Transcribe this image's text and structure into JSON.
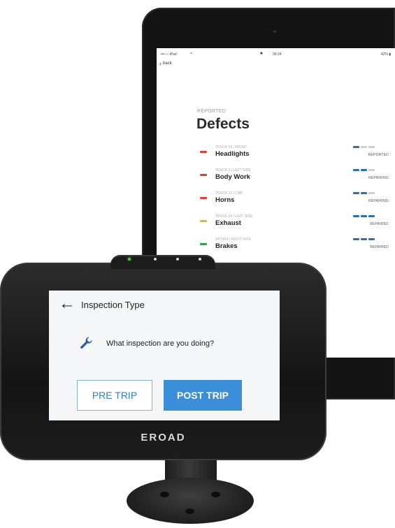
{
  "ipad": {
    "status_bar": {
      "carrier": "•••○○ iPad",
      "wifi_icon": "wifi-icon",
      "lock_icon": "lock-icon",
      "time": "09:24",
      "battery": "  42% ▮"
    },
    "back_label": "back",
    "section_label": "REPORTED",
    "title": "Defects",
    "defects": [
      {
        "sub": "TRUCK 54 | FRONT",
        "name": "Headlights",
        "status": "REPORTED",
        "color": "#e8402f",
        "progress": 1
      },
      {
        "sub": "TRUCK 3 | LEFT SIDE",
        "name": "Body Work",
        "status": "REPAIRING",
        "color": "#e8402f",
        "progress": 2
      },
      {
        "sub": "TRUCK 12 | CAB",
        "name": "Horns",
        "status": "REPAIRING",
        "color": "#e8402f",
        "progress": 2
      },
      {
        "sub": "TRUCK 24 | LEFT SIDE",
        "name": "Exhaust",
        "status": "REPAIRED",
        "color": "#f2b21c",
        "progress": 3
      },
      {
        "sub": "24TUK4 | RIGHT SIDE",
        "name": "Brakes",
        "status": "REPAIRED",
        "color": "#27a844",
        "progress": 3
      }
    ]
  },
  "device": {
    "screen_title": "Inspection Type",
    "question": "What inspection are you doing?",
    "pre_trip_label": "PRE TRIP",
    "post_trip_label": "POST TRIP",
    "brand": "EROAD",
    "accent_color": "#3b8fd9",
    "icons": [
      "back-arrow-icon",
      "wrench-icon"
    ]
  }
}
